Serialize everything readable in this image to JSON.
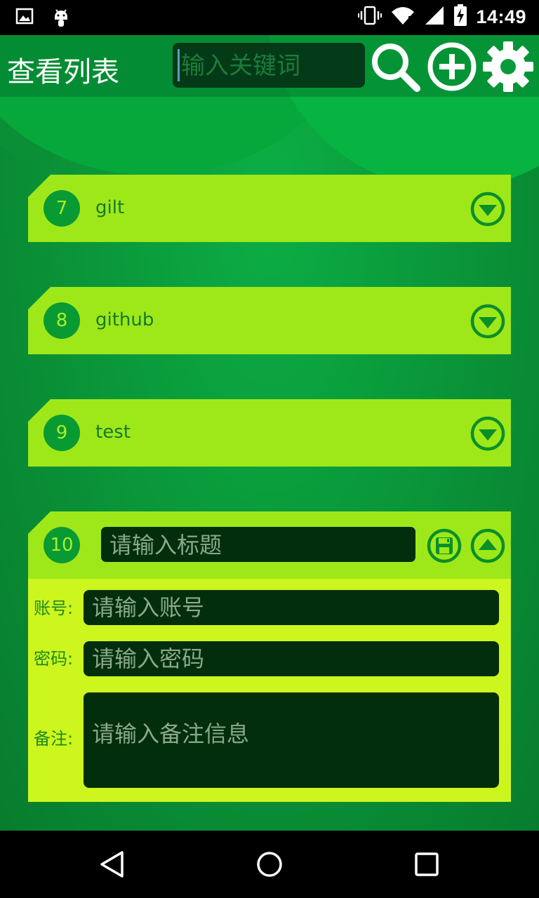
{
  "status_bar": {
    "time": "14:49",
    "left_icons": [
      "image-icon",
      "android-icon"
    ],
    "right_icons": [
      "vibrate-icon",
      "wifi-icon",
      "signal-icon",
      "battery-charging-icon"
    ]
  },
  "app_bar": {
    "title": "查看列表",
    "search_placeholder": "输入关键词",
    "icons": [
      "search-icon",
      "add-circle-icon",
      "settings-gear-icon"
    ]
  },
  "items": [
    {
      "number": "7",
      "title": "gilt"
    },
    {
      "number": "8",
      "title": "github"
    },
    {
      "number": "9",
      "title": "test"
    }
  ],
  "editor": {
    "number": "10",
    "title_placeholder": "请输入标题",
    "account_label": "账号:",
    "account_placeholder": "请输入账号",
    "password_label": "密码:",
    "password_placeholder": "请输入密码",
    "note_label": "备注:",
    "note_placeholder": "请输入备注信息"
  },
  "colors": {
    "card_header": "#9ee81a",
    "card_body": "#cdf51e",
    "circle": "#0a9a34",
    "input_bg": "#022e0e",
    "background": "#0a8a35"
  },
  "nav_bar": {
    "icons": [
      "back-icon",
      "home-icon",
      "recents-icon"
    ]
  }
}
